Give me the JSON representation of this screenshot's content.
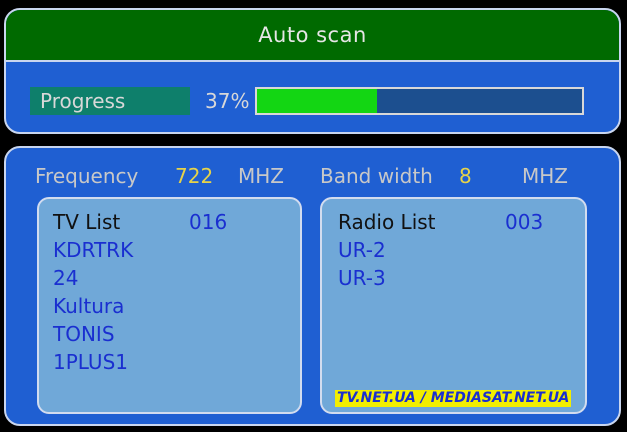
{
  "header": {
    "title": "Auto scan"
  },
  "progress": {
    "label": "Progress",
    "percent_text": "37%",
    "fraction": 0.37
  },
  "info": {
    "frequency_label": "Frequency",
    "frequency_value": "722",
    "frequency_unit": "MHZ",
    "bandwidth_label": "Band width",
    "bandwidth_value": "8",
    "bandwidth_unit": "MHZ"
  },
  "tv_list": {
    "title": "TV List",
    "count": "016",
    "items": [
      "KDRTRK",
      "24",
      "Kultura",
      "TONIS",
      "1PLUS1"
    ]
  },
  "radio_list": {
    "title": "Radio List",
    "count": "003",
    "items": [
      "UR-2",
      "UR-3"
    ]
  },
  "watermark": "TV.NET.UA / MEDIASAT.NET.UA",
  "colors": {
    "title_bar": "#006a00",
    "panel": "#1f5fd2",
    "progress_fill": "#13d613",
    "list_bg": "#70a8d8",
    "accent_value": "#e6d34a"
  }
}
